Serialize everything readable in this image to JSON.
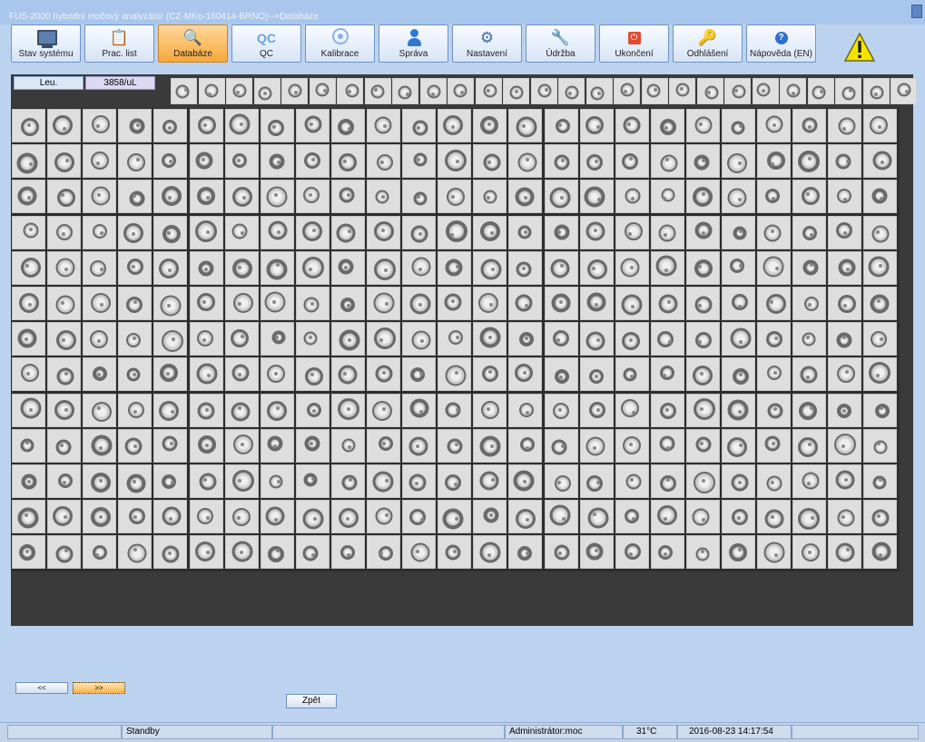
{
  "window": {
    "title": "FUS-2000 hybridní močový analyzátor (CZ-MKo-160414-BRNO)-->Databáze"
  },
  "toolbar": {
    "items": [
      {
        "label": "Stav systému",
        "icon": "monitor-icon",
        "active": false
      },
      {
        "label": "Prac. list",
        "icon": "clipboard-icon",
        "active": false
      },
      {
        "label": "Databáze",
        "icon": "magnifier-icon",
        "active": true
      },
      {
        "label": "QC",
        "icon": "qc-icon",
        "active": false
      },
      {
        "label": "Kalibrace",
        "icon": "target-icon",
        "active": false
      },
      {
        "label": "Správa",
        "icon": "person-icon",
        "active": false
      },
      {
        "label": "Nastavení",
        "icon": "gears-icon",
        "active": false
      },
      {
        "label": "Údržba",
        "icon": "tools-icon",
        "active": false
      },
      {
        "label": "Ukončení",
        "icon": "power-icon",
        "active": false
      },
      {
        "label": "Odhlášení",
        "icon": "keys-icon",
        "active": false
      },
      {
        "label": "Nápověda (EN)",
        "icon": "help-icon",
        "active": false
      }
    ],
    "icon_glyphs": {
      "clipboard": "📋",
      "magnifier": "🔍",
      "qc": "QC",
      "gears": "⚙",
      "tools": "🔧",
      "keys": "🔑",
      "power": "⏻",
      "help": "?"
    },
    "warning_icon": "warning-icon"
  },
  "category": {
    "label": "Leu.",
    "count": "3858/uL"
  },
  "navigation": {
    "prev_label": "<<",
    "next_label": ">>",
    "back_label": "Zpět"
  },
  "status_bar": {
    "state": "Standby",
    "user": "Administrátor:moc",
    "temperature": "31°C",
    "datetime": "2016-08-23 14:17:54"
  },
  "colors": {
    "background": "#bcd3f0",
    "active_tab": "#f6a83c",
    "grid_frame": "#3a3a3a",
    "cell_background": "#dedede",
    "warning": "#f3e400"
  }
}
